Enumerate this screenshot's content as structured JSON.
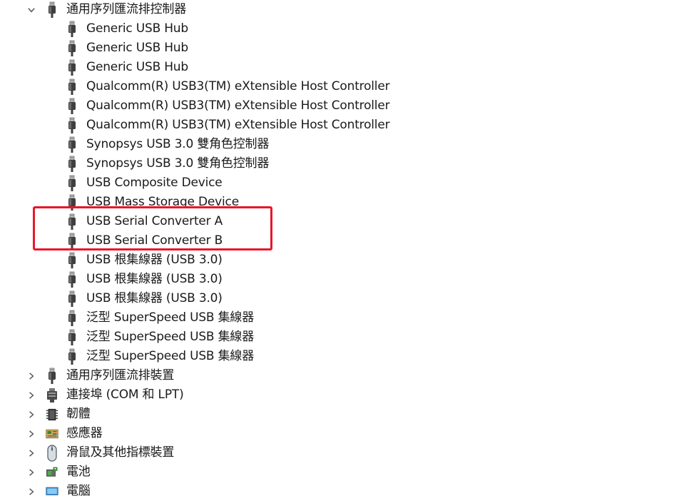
{
  "tree": {
    "usb_controllers": {
      "label": "通用序列匯流排控制器",
      "expanded": true,
      "children": [
        "Generic USB Hub",
        "Generic USB Hub",
        "Generic USB Hub",
        "Qualcomm(R) USB3(TM) eXtensible Host Controller",
        "Qualcomm(R) USB3(TM) eXtensible Host Controller",
        "Qualcomm(R) USB3(TM) eXtensible Host Controller",
        "Synopsys USB 3.0 雙角色控制器",
        "Synopsys USB 3.0 雙角色控制器",
        "USB Composite Device",
        "USB Mass Storage Device",
        "USB Serial Converter A",
        "USB Serial Converter B",
        "USB 根集線器 (USB 3.0)",
        "USB 根集線器 (USB 3.0)",
        "USB 根集線器 (USB 3.0)",
        "泛型 SuperSpeed USB 集線器",
        "泛型 SuperSpeed USB 集線器",
        "泛型 SuperSpeed USB 集線器"
      ]
    },
    "categories": [
      {
        "label": "通用序列匯流排裝置",
        "icon": "usb-plug-icon"
      },
      {
        "label": "連接埠 (COM 和 LPT)",
        "icon": "port-icon"
      },
      {
        "label": "韌體",
        "icon": "chip-icon"
      },
      {
        "label": "感應器",
        "icon": "sensor-icon"
      },
      {
        "label": "滑鼠及其他指標裝置",
        "icon": "mouse-icon"
      },
      {
        "label": "電池",
        "icon": "battery-icon"
      },
      {
        "label": "電腦",
        "icon": "computer-icon"
      }
    ]
  },
  "colors": {
    "highlight_border": "#e8162b",
    "text": "#1a1a1a"
  }
}
